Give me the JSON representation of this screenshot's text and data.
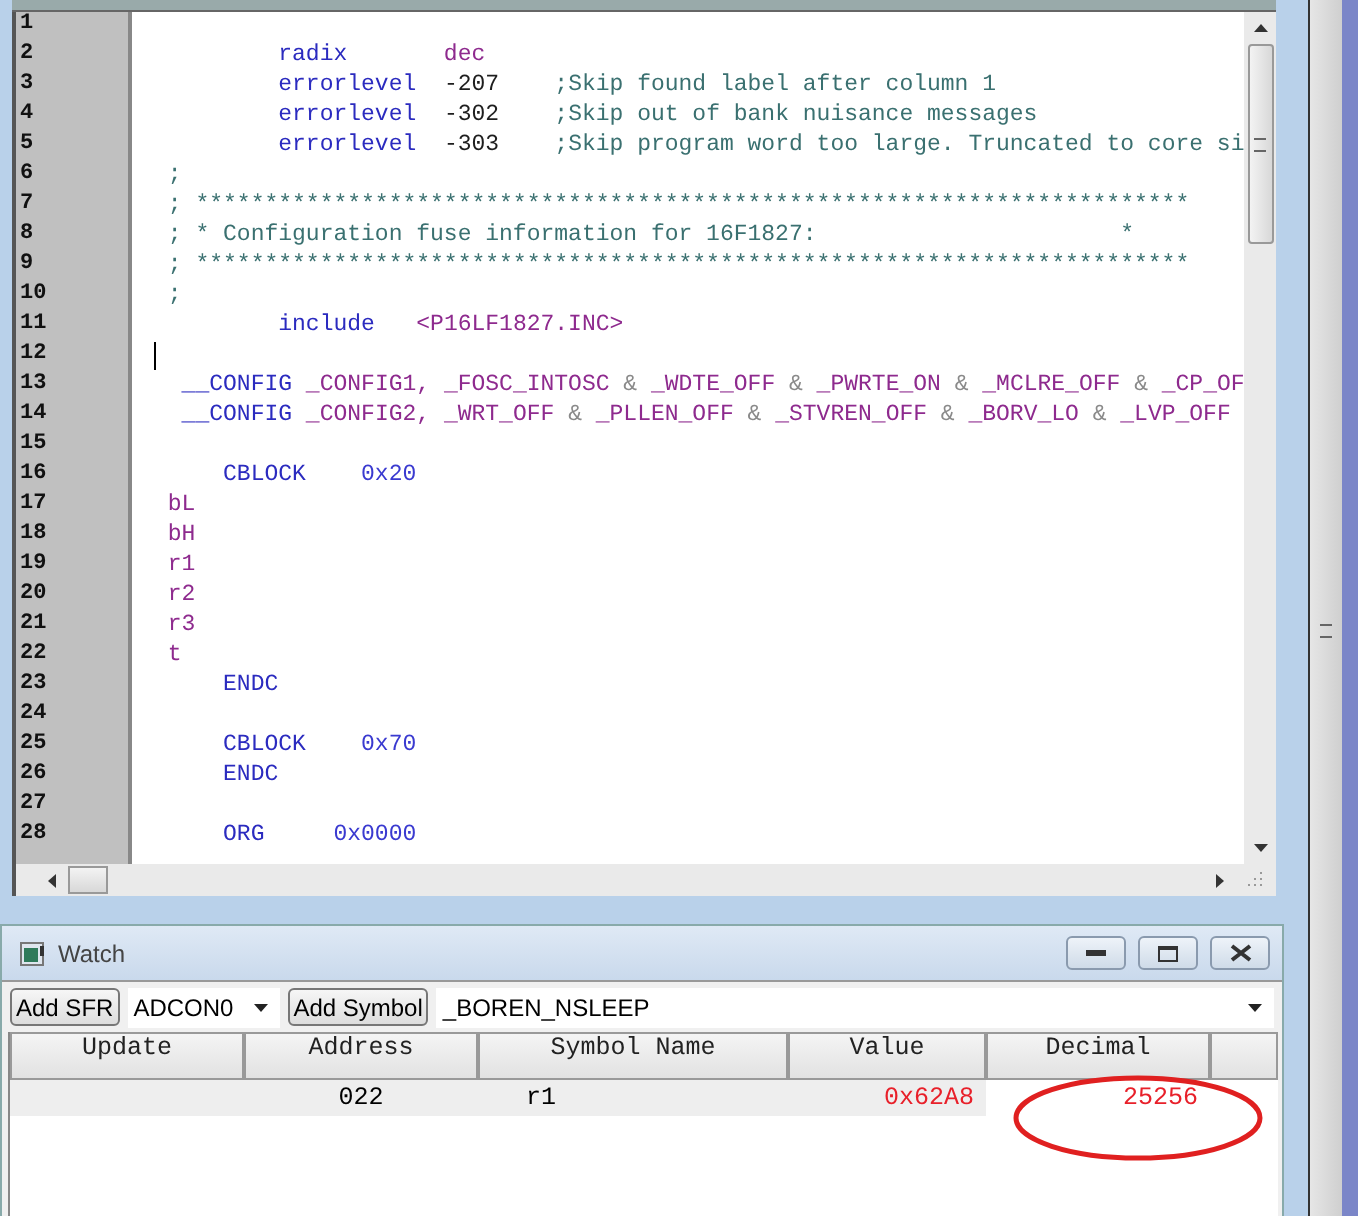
{
  "editor": {
    "lines": [
      {
        "number": "1"
      },
      {
        "number": "2",
        "tokens": [
          {
            "text": "        radix",
            "kind": "keyword"
          },
          {
            "text": "       dec",
            "kind": "symbol"
          }
        ]
      },
      {
        "number": "3",
        "tokens": [
          {
            "text": "        errorlevel",
            "kind": "keyword"
          },
          {
            "text": "  -207",
            "kind": "number"
          },
          {
            "text": "    ;Skip found label after column 1",
            "kind": "comment"
          }
        ]
      },
      {
        "number": "4",
        "tokens": [
          {
            "text": "        errorlevel",
            "kind": "keyword"
          },
          {
            "text": "  -302",
            "kind": "number"
          },
          {
            "text": "    ;Skip out of bank nuisance messages",
            "kind": "comment"
          }
        ]
      },
      {
        "number": "5",
        "tokens": [
          {
            "text": "        errorlevel",
            "kind": "keyword"
          },
          {
            "text": "  -303",
            "kind": "number"
          },
          {
            "text": "    ;Skip program word too large. Truncated to core si",
            "kind": "comment"
          }
        ]
      },
      {
        "number": "6",
        "tokens": [
          {
            "text": ";",
            "kind": "comment"
          }
        ]
      },
      {
        "number": "7",
        "tokens": [
          {
            "text": "; ************************************************************************",
            "kind": "comment"
          }
        ]
      },
      {
        "number": "8",
        "tokens": [
          {
            "text": "; * Configuration fuse information for 16F1827:                      *",
            "kind": "comment"
          }
        ]
      },
      {
        "number": "9",
        "tokens": [
          {
            "text": "; ************************************************************************",
            "kind": "comment"
          }
        ]
      },
      {
        "number": "10",
        "tokens": [
          {
            "text": ";",
            "kind": "comment"
          }
        ]
      },
      {
        "number": "11",
        "tokens": [
          {
            "text": "        include",
            "kind": "keyword"
          },
          {
            "text": "   <P16LF1827.INC>",
            "kind": "symbol"
          }
        ]
      },
      {
        "number": "12",
        "cursor": true
      },
      {
        "number": "13",
        "tokens": [
          {
            "text": " __CONFIG",
            "kind": "keyword"
          },
          {
            "text": " _CONFIG1, _FOSC_INTOSC ",
            "kind": "symbol"
          },
          {
            "text": "&",
            "kind": "operator"
          },
          {
            "text": " _WDTE_OFF ",
            "kind": "symbol"
          },
          {
            "text": "&",
            "kind": "operator"
          },
          {
            "text": " _PWRTE_ON ",
            "kind": "symbol"
          },
          {
            "text": "&",
            "kind": "operator"
          },
          {
            "text": " _MCLRE_OFF ",
            "kind": "symbol"
          },
          {
            "text": "&",
            "kind": "operator"
          },
          {
            "text": " _CP_OF",
            "kind": "symbol"
          }
        ]
      },
      {
        "number": "14",
        "tokens": [
          {
            "text": " __CONFIG",
            "kind": "keyword"
          },
          {
            "text": " _CONFIG2, _WRT_OFF ",
            "kind": "symbol"
          },
          {
            "text": "&",
            "kind": "operator"
          },
          {
            "text": " _PLLEN_OFF ",
            "kind": "symbol"
          },
          {
            "text": "&",
            "kind": "operator"
          },
          {
            "text": " _STVREN_OFF ",
            "kind": "symbol"
          },
          {
            "text": "&",
            "kind": "operator"
          },
          {
            "text": " _BORV_LO ",
            "kind": "symbol"
          },
          {
            "text": "&",
            "kind": "operator"
          },
          {
            "text": " _LVP_OFF",
            "kind": "symbol"
          }
        ]
      },
      {
        "number": "15"
      },
      {
        "number": "16",
        "tokens": [
          {
            "text": "    CBLOCK",
            "kind": "keyword"
          },
          {
            "text": "    0x20",
            "kind": "hex"
          }
        ]
      },
      {
        "number": "17",
        "tokens": [
          {
            "text": "bL",
            "kind": "symbol"
          }
        ]
      },
      {
        "number": "18",
        "tokens": [
          {
            "text": "bH",
            "kind": "symbol"
          }
        ]
      },
      {
        "number": "19",
        "tokens": [
          {
            "text": "r1",
            "kind": "symbol"
          }
        ]
      },
      {
        "number": "20",
        "tokens": [
          {
            "text": "r2",
            "kind": "symbol"
          }
        ]
      },
      {
        "number": "21",
        "tokens": [
          {
            "text": "r3",
            "kind": "symbol"
          }
        ]
      },
      {
        "number": "22",
        "tokens": [
          {
            "text": "t",
            "kind": "symbol"
          }
        ]
      },
      {
        "number": "23",
        "tokens": [
          {
            "text": "    ENDC",
            "kind": "keyword"
          }
        ]
      },
      {
        "number": "24"
      },
      {
        "number": "25",
        "tokens": [
          {
            "text": "    CBLOCK",
            "kind": "keyword"
          },
          {
            "text": "    0x70",
            "kind": "hex"
          }
        ]
      },
      {
        "number": "26",
        "tokens": [
          {
            "text": "    ENDC",
            "kind": "keyword"
          }
        ]
      },
      {
        "number": "27"
      },
      {
        "number": "28",
        "tokens": [
          {
            "text": "    ORG",
            "kind": "keyword"
          },
          {
            "text": "     0x0000",
            "kind": "hex"
          }
        ]
      }
    ]
  },
  "watch": {
    "title": "Watch",
    "add_sfr_button": "Add SFR",
    "sfr_select": {
      "value": "ADCON0"
    },
    "add_symbol_button": "Add Symbol",
    "symbol_select": {
      "value": "_BOREN_NSLEEP"
    },
    "table": {
      "columns": [
        "Update",
        "Address",
        "Symbol Name",
        "Value",
        "Decimal"
      ],
      "rows": [
        {
          "address": "022",
          "symbol_name": "r1",
          "value": "0x62A8",
          "decimal": "25256",
          "changed": true
        }
      ]
    }
  }
}
